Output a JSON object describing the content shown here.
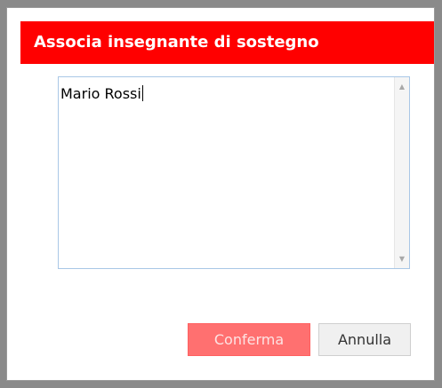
{
  "dialog": {
    "title": "Associa insegnante di sostegno",
    "textarea": {
      "value": "Mario Rossi",
      "scroll_up_icon": "triangle-up",
      "scroll_down_icon": "triangle-down"
    },
    "buttons": {
      "confirm_label": "Conferma",
      "cancel_label": "Annulla"
    }
  },
  "colors": {
    "title_bar": "#ff0000",
    "confirm_button": "#ff7070",
    "cancel_button": "#f0f0f0",
    "textarea_border": "#a9c7e6"
  }
}
